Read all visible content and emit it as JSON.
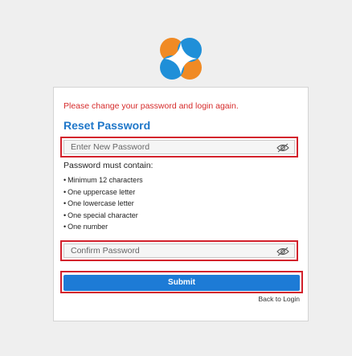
{
  "brand": {
    "logo_icon": "four-point-star-logo",
    "colors": {
      "orange": "#f08a24",
      "blue": "#1f8fd8"
    }
  },
  "form": {
    "alert_text": "Please change your password and login again.",
    "title": "Reset Password",
    "new_password": {
      "placeholder": "Enter New Password",
      "value": "",
      "toggle_icon": "eye-slash-icon"
    },
    "rules_heading": "Password must contain:",
    "rules": [
      "Minimum 12 characters",
      "One uppercase letter",
      "One lowercase letter",
      "One special character",
      "One number"
    ],
    "confirm_password": {
      "placeholder": "Confirm Password",
      "value": "",
      "toggle_icon": "eye-slash-icon"
    },
    "submit_label": "Submit",
    "back_link": "Back to Login"
  },
  "colors": {
    "alert": "#d62b2b",
    "title": "#1f77c9",
    "button": "#1d7bd6",
    "highlight_outline": "#d3212c",
    "background": "#efefef"
  }
}
